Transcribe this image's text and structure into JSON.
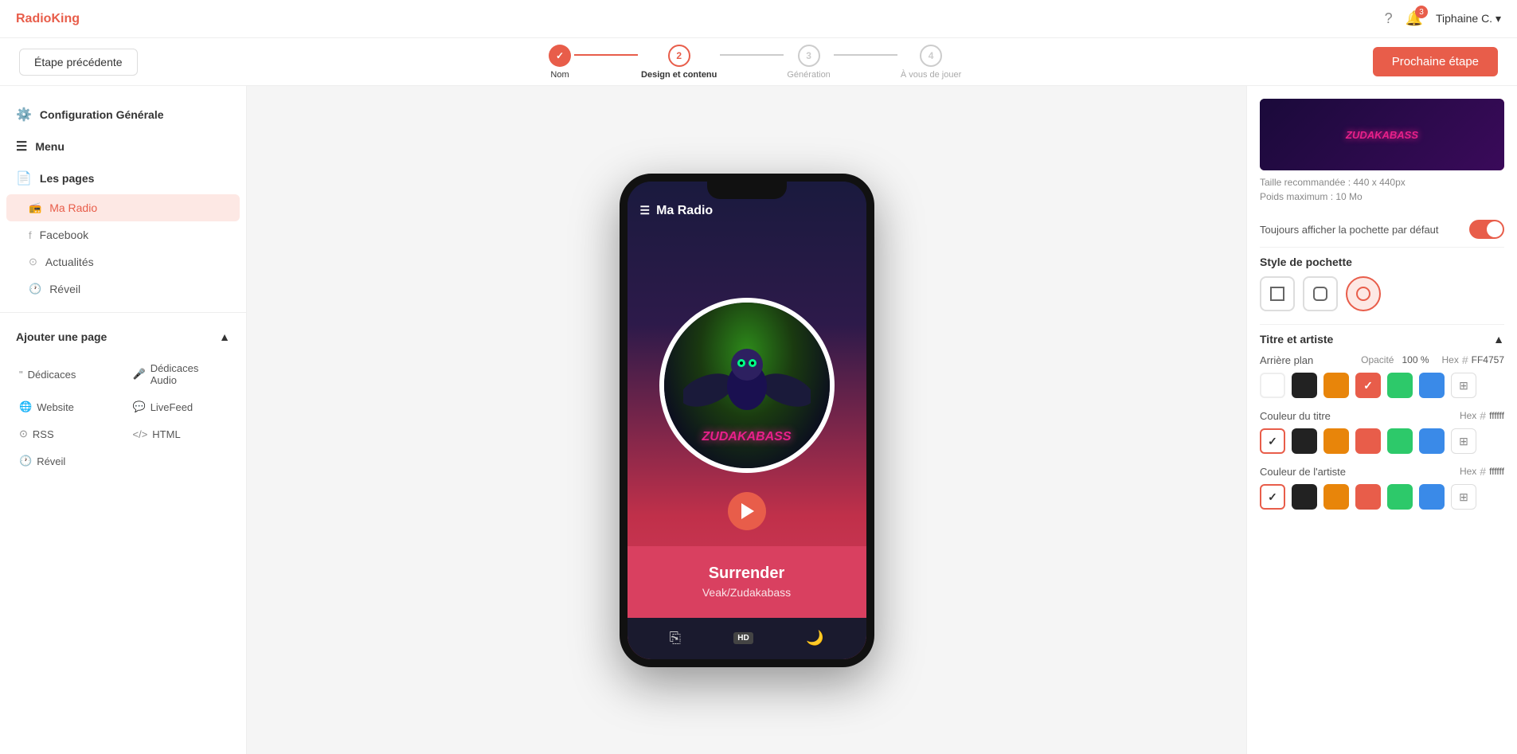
{
  "app": {
    "logo": "RadioKing",
    "logo_color": "Radio",
    "logo_black": "King"
  },
  "topnav": {
    "help_icon": "?",
    "notification_badge": "3",
    "user_name": "Tiphaine C."
  },
  "header": {
    "prev_button": "Étape précédente",
    "next_button": "Prochaine étape",
    "steps": [
      {
        "label": "Nom",
        "number": "1",
        "state": "done"
      },
      {
        "label": "Design et contenu",
        "number": "2",
        "state": "active"
      },
      {
        "label": "Génération",
        "number": "3",
        "state": "inactive"
      },
      {
        "label": "À vous de jouer",
        "number": "4",
        "state": "inactive"
      }
    ]
  },
  "sidebar": {
    "config_title": "Configuration Générale",
    "menu_title": "Menu",
    "pages_title": "Les pages",
    "pages": [
      {
        "label": "Ma Radio",
        "icon": "📻",
        "active": true
      },
      {
        "label": "Facebook",
        "icon": "fb"
      },
      {
        "label": "Actualités",
        "icon": "rss"
      },
      {
        "label": "Réveil",
        "icon": "clock"
      }
    ],
    "add_page_title": "Ajouter une page",
    "add_page_items": [
      {
        "label": "Dédicaces",
        "icon": "quote"
      },
      {
        "label": "Dédicaces Audio",
        "icon": "mic"
      },
      {
        "label": "Website",
        "icon": "globe"
      },
      {
        "label": "LiveFeed",
        "icon": "chat"
      },
      {
        "label": "RSS",
        "icon": "rss"
      },
      {
        "label": "HTML",
        "icon": "code"
      },
      {
        "label": "Réveil",
        "icon": "clock"
      }
    ]
  },
  "phone": {
    "title": "Ma Radio",
    "song_title": "Surrender",
    "song_artist": "Veak/Zudakabass",
    "album_text": "ZUDAKABASS",
    "hd_label": "HD"
  },
  "right_panel": {
    "cover_size_text": "Taille recommandée : 440 x 440px",
    "cover_weight_text": "Poids maximum : 10 Mo",
    "always_show_label": "Toujours afficher la pochette par défaut",
    "style_title": "Style de pochette",
    "style_options": [
      {
        "shape": "square",
        "active": false
      },
      {
        "shape": "rounded",
        "active": false
      },
      {
        "shape": "circle",
        "active": true
      }
    ],
    "title_artist_section": "Titre et artiste",
    "background_label": "Arrière plan",
    "opacity_label": "Opacité",
    "opacity_value": "100 %",
    "hex_label": "Hex",
    "hex_value": "FF4757",
    "title_color_label": "Couleur du titre",
    "title_hex_label": "Hex",
    "title_hex_value": "ffffff",
    "artist_color_label": "Couleur de l'artiste",
    "artist_hex_label": "Hex",
    "artist_hex_value": "ffffff",
    "bg_swatches": [
      {
        "color": "#222",
        "selected": false
      },
      {
        "color": "#e8850a",
        "selected": false
      },
      {
        "color": "#e85d4a",
        "selected": true
      },
      {
        "color": "#2dc96a",
        "selected": false
      },
      {
        "color": "#3a8ae8",
        "selected": false
      }
    ],
    "title_swatches": [
      {
        "color": "#ffffff",
        "selected": true,
        "white": true
      },
      {
        "color": "#222",
        "selected": false
      },
      {
        "color": "#e8850a",
        "selected": false
      },
      {
        "color": "#e85d4a",
        "selected": false
      },
      {
        "color": "#2dc96a",
        "selected": false
      },
      {
        "color": "#3a8ae8",
        "selected": false
      }
    ],
    "artist_swatches": [
      {
        "color": "#ffffff",
        "selected": true,
        "white": true
      },
      {
        "color": "#222",
        "selected": false
      },
      {
        "color": "#e8850a",
        "selected": false
      },
      {
        "color": "#e85d4a",
        "selected": false
      },
      {
        "color": "#2dc96a",
        "selected": false
      },
      {
        "color": "#3a8ae8",
        "selected": false
      }
    ]
  }
}
